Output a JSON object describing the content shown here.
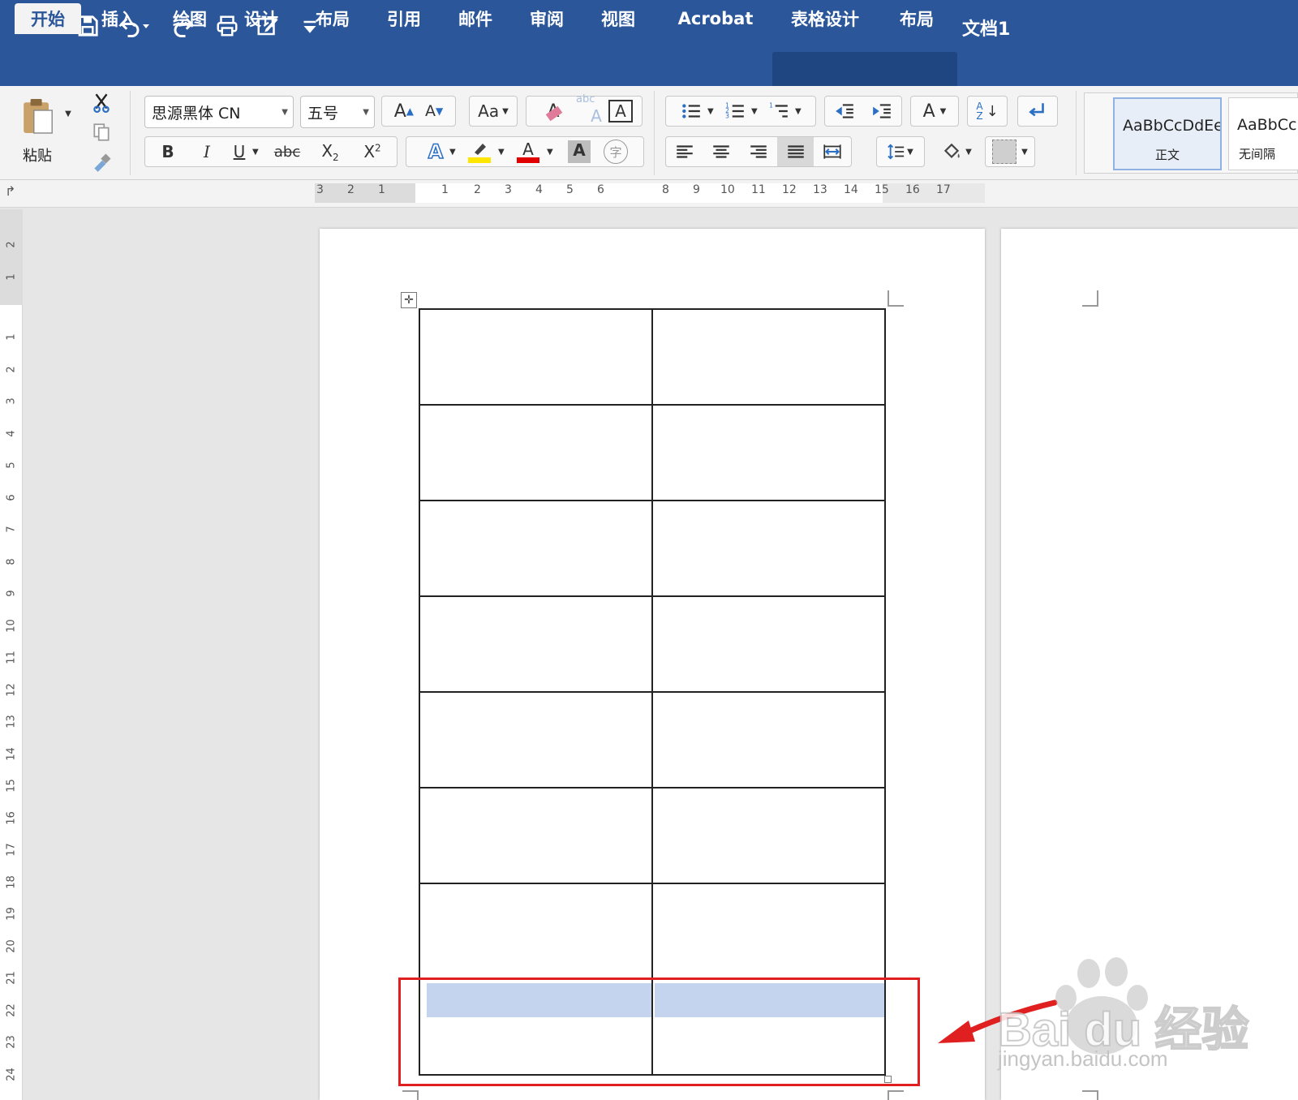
{
  "titlebar": {
    "doc_title": "文档1"
  },
  "tabs": [
    {
      "label": "开始",
      "active": true
    },
    {
      "label": "插入"
    },
    {
      "label": "绘图"
    },
    {
      "label": "设计"
    },
    {
      "label": "布局"
    },
    {
      "label": "引用"
    },
    {
      "label": "邮件"
    },
    {
      "label": "审阅"
    },
    {
      "label": "视图"
    },
    {
      "label": "Acrobat"
    },
    {
      "label": "表格设计"
    },
    {
      "label": "布局"
    }
  ],
  "ribbon": {
    "paste_label": "粘贴",
    "font_name": "思源黑体 CN",
    "font_size": "五号",
    "grow_font": "A",
    "shrink_font": "A",
    "change_case": "Aa",
    "clear_format_letter": "A",
    "phonetic_small": "abc",
    "phonetic_big": "A",
    "char_border": "A",
    "bold": "B",
    "italic": "I",
    "underline": "U",
    "strikethrough": "abc",
    "subscript_base": "X",
    "subscript_mark": "2",
    "superscript_base": "X",
    "superscript_mark": "2",
    "text_effect": "A",
    "font_color_letter": "A",
    "char_shading": "A",
    "enclose_char": "字",
    "asian_layout": "A",
    "sort_top": "A",
    "sort_bottom": "Z",
    "highlight_color": "#ffe600",
    "font_color": "#e00000",
    "styles": [
      {
        "sample": "AaBbCcDdEe",
        "name": "正文",
        "selected": true
      },
      {
        "sample": "AaBbCcD",
        "name": "无间隔"
      }
    ]
  },
  "hruler": {
    "left_numbers": [
      "3",
      "2",
      "1"
    ],
    "right_numbers": [
      "1",
      "2",
      "3",
      "4",
      "5",
      "6",
      "8",
      "9",
      "10",
      "11",
      "12",
      "13",
      "14",
      "15",
      "16",
      "17"
    ]
  },
  "vruler": {
    "numbers": [
      "2",
      "1",
      "1",
      "2",
      "3",
      "4",
      "5",
      "6",
      "7",
      "8",
      "9",
      "10",
      "11",
      "12",
      "13",
      "14",
      "15",
      "16",
      "17",
      "18",
      "19",
      "20",
      "21",
      "22",
      "23",
      "24"
    ]
  },
  "table": {
    "rows": 8,
    "cols": 2,
    "selected_row": 8
  },
  "watermark": {
    "brand": "Bai du 经验",
    "url": "jingyan.baidu.com"
  },
  "colors": {
    "accent": "#2b579a",
    "annotation": "#e02020",
    "selection": "#c5d4ee"
  }
}
